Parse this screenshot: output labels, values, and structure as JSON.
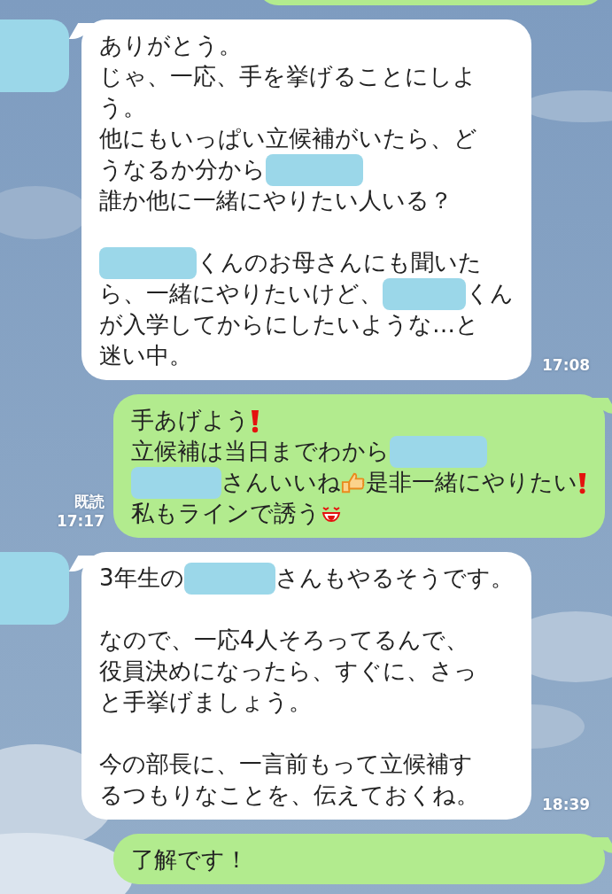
{
  "messages": [
    {
      "kind": "incoming",
      "time": "17:08",
      "paragraphs": [
        [
          [
            {
              "kind": "text",
              "text": "ありがとう。"
            }
          ],
          [
            {
              "kind": "text",
              "text": "じゃ、一応、手を挙げることにしよ"
            }
          ],
          [
            {
              "kind": "text",
              "text": "う。"
            }
          ],
          [
            {
              "kind": "text",
              "text": "他にもいっぱい立候補がいたら、ど"
            }
          ],
          [
            {
              "kind": "text",
              "text": "うなるか分から"
            },
            {
              "kind": "redacted"
            }
          ],
          [
            {
              "kind": "text",
              "text": "誰か他に一緒にやりたい人いる？"
            }
          ]
        ],
        [
          [
            {
              "kind": "redacted"
            },
            {
              "kind": "text",
              "text": "くんのお母さんにも聞いた"
            }
          ],
          [
            {
              "kind": "text",
              "text": "ら、一緒にやりたいけど、"
            },
            {
              "kind": "redacted"
            },
            {
              "kind": "text",
              "text": "くん"
            }
          ],
          [
            {
              "kind": "text",
              "text": "が入学してからにしたいような…と"
            }
          ],
          [
            {
              "kind": "text",
              "text": "迷い中。"
            }
          ]
        ]
      ]
    },
    {
      "kind": "outgoing",
      "read": "既読",
      "time": "17:17",
      "paragraphs": [
        [
          [
            {
              "kind": "text",
              "text": "手あげよう"
            },
            {
              "kind": "exclaim"
            }
          ],
          [
            {
              "kind": "text",
              "text": "立候補は当日までわから"
            },
            {
              "kind": "redacted"
            }
          ],
          [
            {
              "kind": "redacted"
            },
            {
              "kind": "text",
              "text": "さんいいね"
            },
            {
              "kind": "thumb"
            },
            {
              "kind": "text",
              "text": "是非一緒にやりたい"
            },
            {
              "kind": "exclaim"
            }
          ],
          [
            {
              "kind": "text",
              "text": "私もラインで誘う"
            },
            {
              "kind": "face"
            }
          ]
        ]
      ]
    },
    {
      "kind": "incoming",
      "time": "18:39",
      "paragraphs": [
        [
          [
            {
              "kind": "text",
              "text": "3年生の"
            },
            {
              "kind": "redacted"
            },
            {
              "kind": "text",
              "text": "さんもやるそうです。"
            }
          ]
        ],
        [
          [
            {
              "kind": "text",
              "text": "なので、一応4人そろってるんで、"
            }
          ],
          [
            {
              "kind": "text",
              "text": "役員決めになったら、すぐに、さっ"
            }
          ],
          [
            {
              "kind": "text",
              "text": "と手挙げましょう。"
            }
          ]
        ],
        [
          [
            {
              "kind": "text",
              "text": "今の部長に、一言前もって立候補す"
            }
          ],
          [
            {
              "kind": "text",
              "text": "るつもりなことを、伝えておくね。"
            }
          ]
        ]
      ]
    },
    {
      "kind": "outgoing",
      "paragraphs": [
        [
          [
            {
              "kind": "text",
              "text": "了解です！"
            }
          ]
        ]
      ]
    }
  ]
}
